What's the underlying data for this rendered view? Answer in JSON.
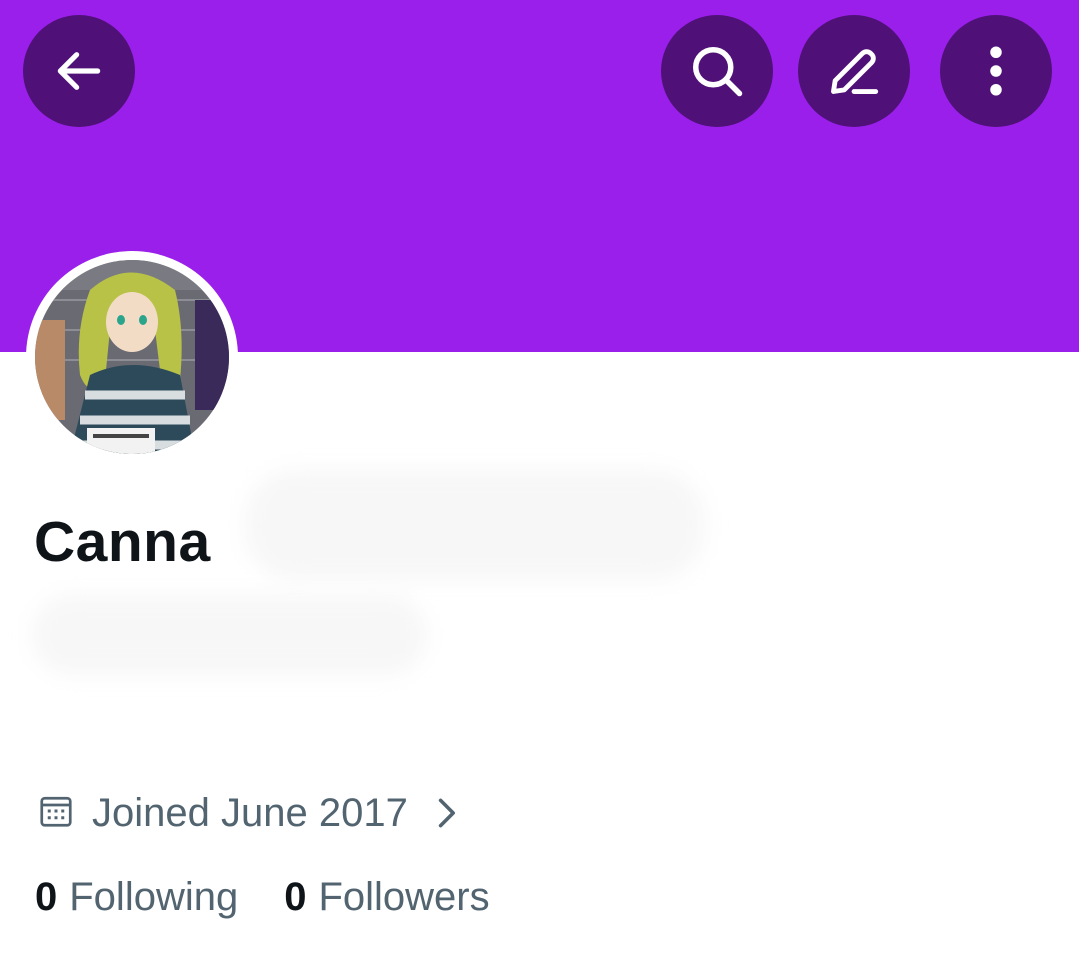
{
  "header": {
    "back_icon": "arrow-left-icon",
    "search_icon": "search-icon",
    "edit_icon": "pencil-icon",
    "more_icon": "more-vertical-icon",
    "banner_color": "#9a1fea",
    "button_color": "#4f1177"
  },
  "profile": {
    "display_name": "Canna",
    "joined": "Joined June 2017",
    "calendar_icon": "calendar-icon",
    "chevron_icon": "chevron-right-icon",
    "following_count": "0",
    "following_label": "Following",
    "followers_count": "0",
    "followers_label": "Followers"
  },
  "colors": {
    "text_primary": "#0f1419",
    "text_secondary": "#536471"
  }
}
